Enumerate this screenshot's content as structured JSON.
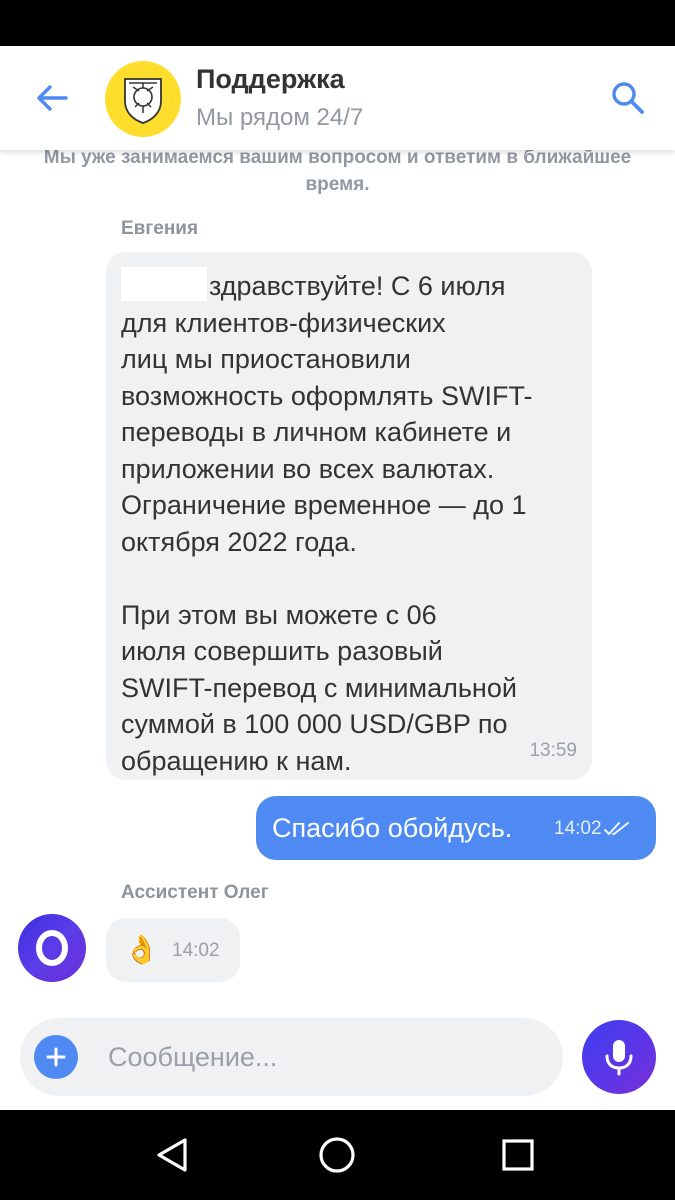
{
  "header": {
    "title": "Поддержка",
    "subtitle": "Мы рядом 24/7"
  },
  "notice": "Мы уже занимаемся вашим вопросом и ответим в ближайшее время.",
  "messages": [
    {
      "sender": "Евгения",
      "text": "здравствуйте! С 6 июля\nдля клиентов-физических\nлиц мы приостановили\nвозможность оформлять SWIFT-\nпереводы в личном кабинете и\nприложении во всех валютах.\nОграничение временное — до 1\nоктября 2022 года.\n\nПри этом вы можете с 06\nиюля совершить разовый\nSWIFT-перевод с минимальной\nсуммой в 100 000 USD/GBP по\nобращению к нам.",
      "time": "13:59"
    },
    {
      "text": "Спасибо обойдусь.",
      "time": "14:02"
    },
    {
      "sender": "Ассистент Олег",
      "text": "👌",
      "time": "14:02"
    }
  ],
  "input": {
    "placeholder": "Сообщение..."
  },
  "colors": {
    "accent": "#4f8af2",
    "bank_yellow": "#ffdd2d",
    "bubble_incoming": "#f0f1f3"
  },
  "icons": [
    "back-arrow-icon",
    "bank-logo-icon",
    "search-icon",
    "plus-icon",
    "microphone-icon",
    "double-check-icon",
    "nav-back-icon",
    "nav-home-icon",
    "nav-recents-icon"
  ]
}
